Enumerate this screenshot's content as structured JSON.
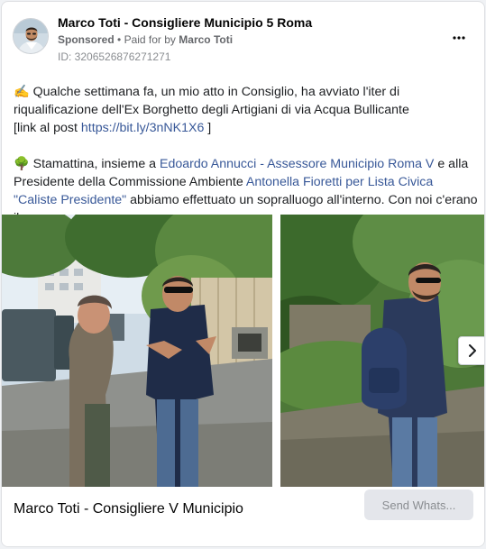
{
  "post": {
    "author": "Marco Toti - Consigliere Municipio 5 Roma",
    "sponsored_label": "Sponsored",
    "separator": "•",
    "paid_for_label": "Paid for by",
    "paid_for_name": "Marco Toti",
    "ad_id": "ID: 3206526876271271",
    "more_icon": "more-horizontal-icon"
  },
  "body": {
    "p1_emoji": "✍️",
    "p1_text": "Qualche settimana fa, un mio atto in Consiglio, ha avviato l'iter di riqualificazione dell'Ex Borghetto degli Artigiani di via Acqua Bullicante",
    "p1_link_prefix": "[link al post ",
    "p1_link": "https://bit.ly/3nNK1X6",
    "p1_link_suffix": " ]",
    "p2_emoji": "🌳",
    "p2_text_a": "Stamattina, insieme a ",
    "p2_mention_1": "Edoardo Annucci - Assessore Municipio Roma V",
    "p2_text_b": " e alla Presidente della Commissione Ambiente ",
    "p2_mention_2": "Antonella Fioretti per Lista Civica \"Caliste Presidente\"",
    "p2_text_c": " abbiamo effettuato un sopralluogo all'interno. Con noi c'erano il..."
  },
  "carousel": {
    "next_icon": "chevron-right-icon"
  },
  "footer": {
    "page_name": "Marco Toti - Consigliere V Municipio",
    "cta_label": "Send Whats..."
  },
  "colors": {
    "link": "#385898",
    "cta_bg": "#e4e6eb",
    "cta_text": "#8a8d91"
  }
}
